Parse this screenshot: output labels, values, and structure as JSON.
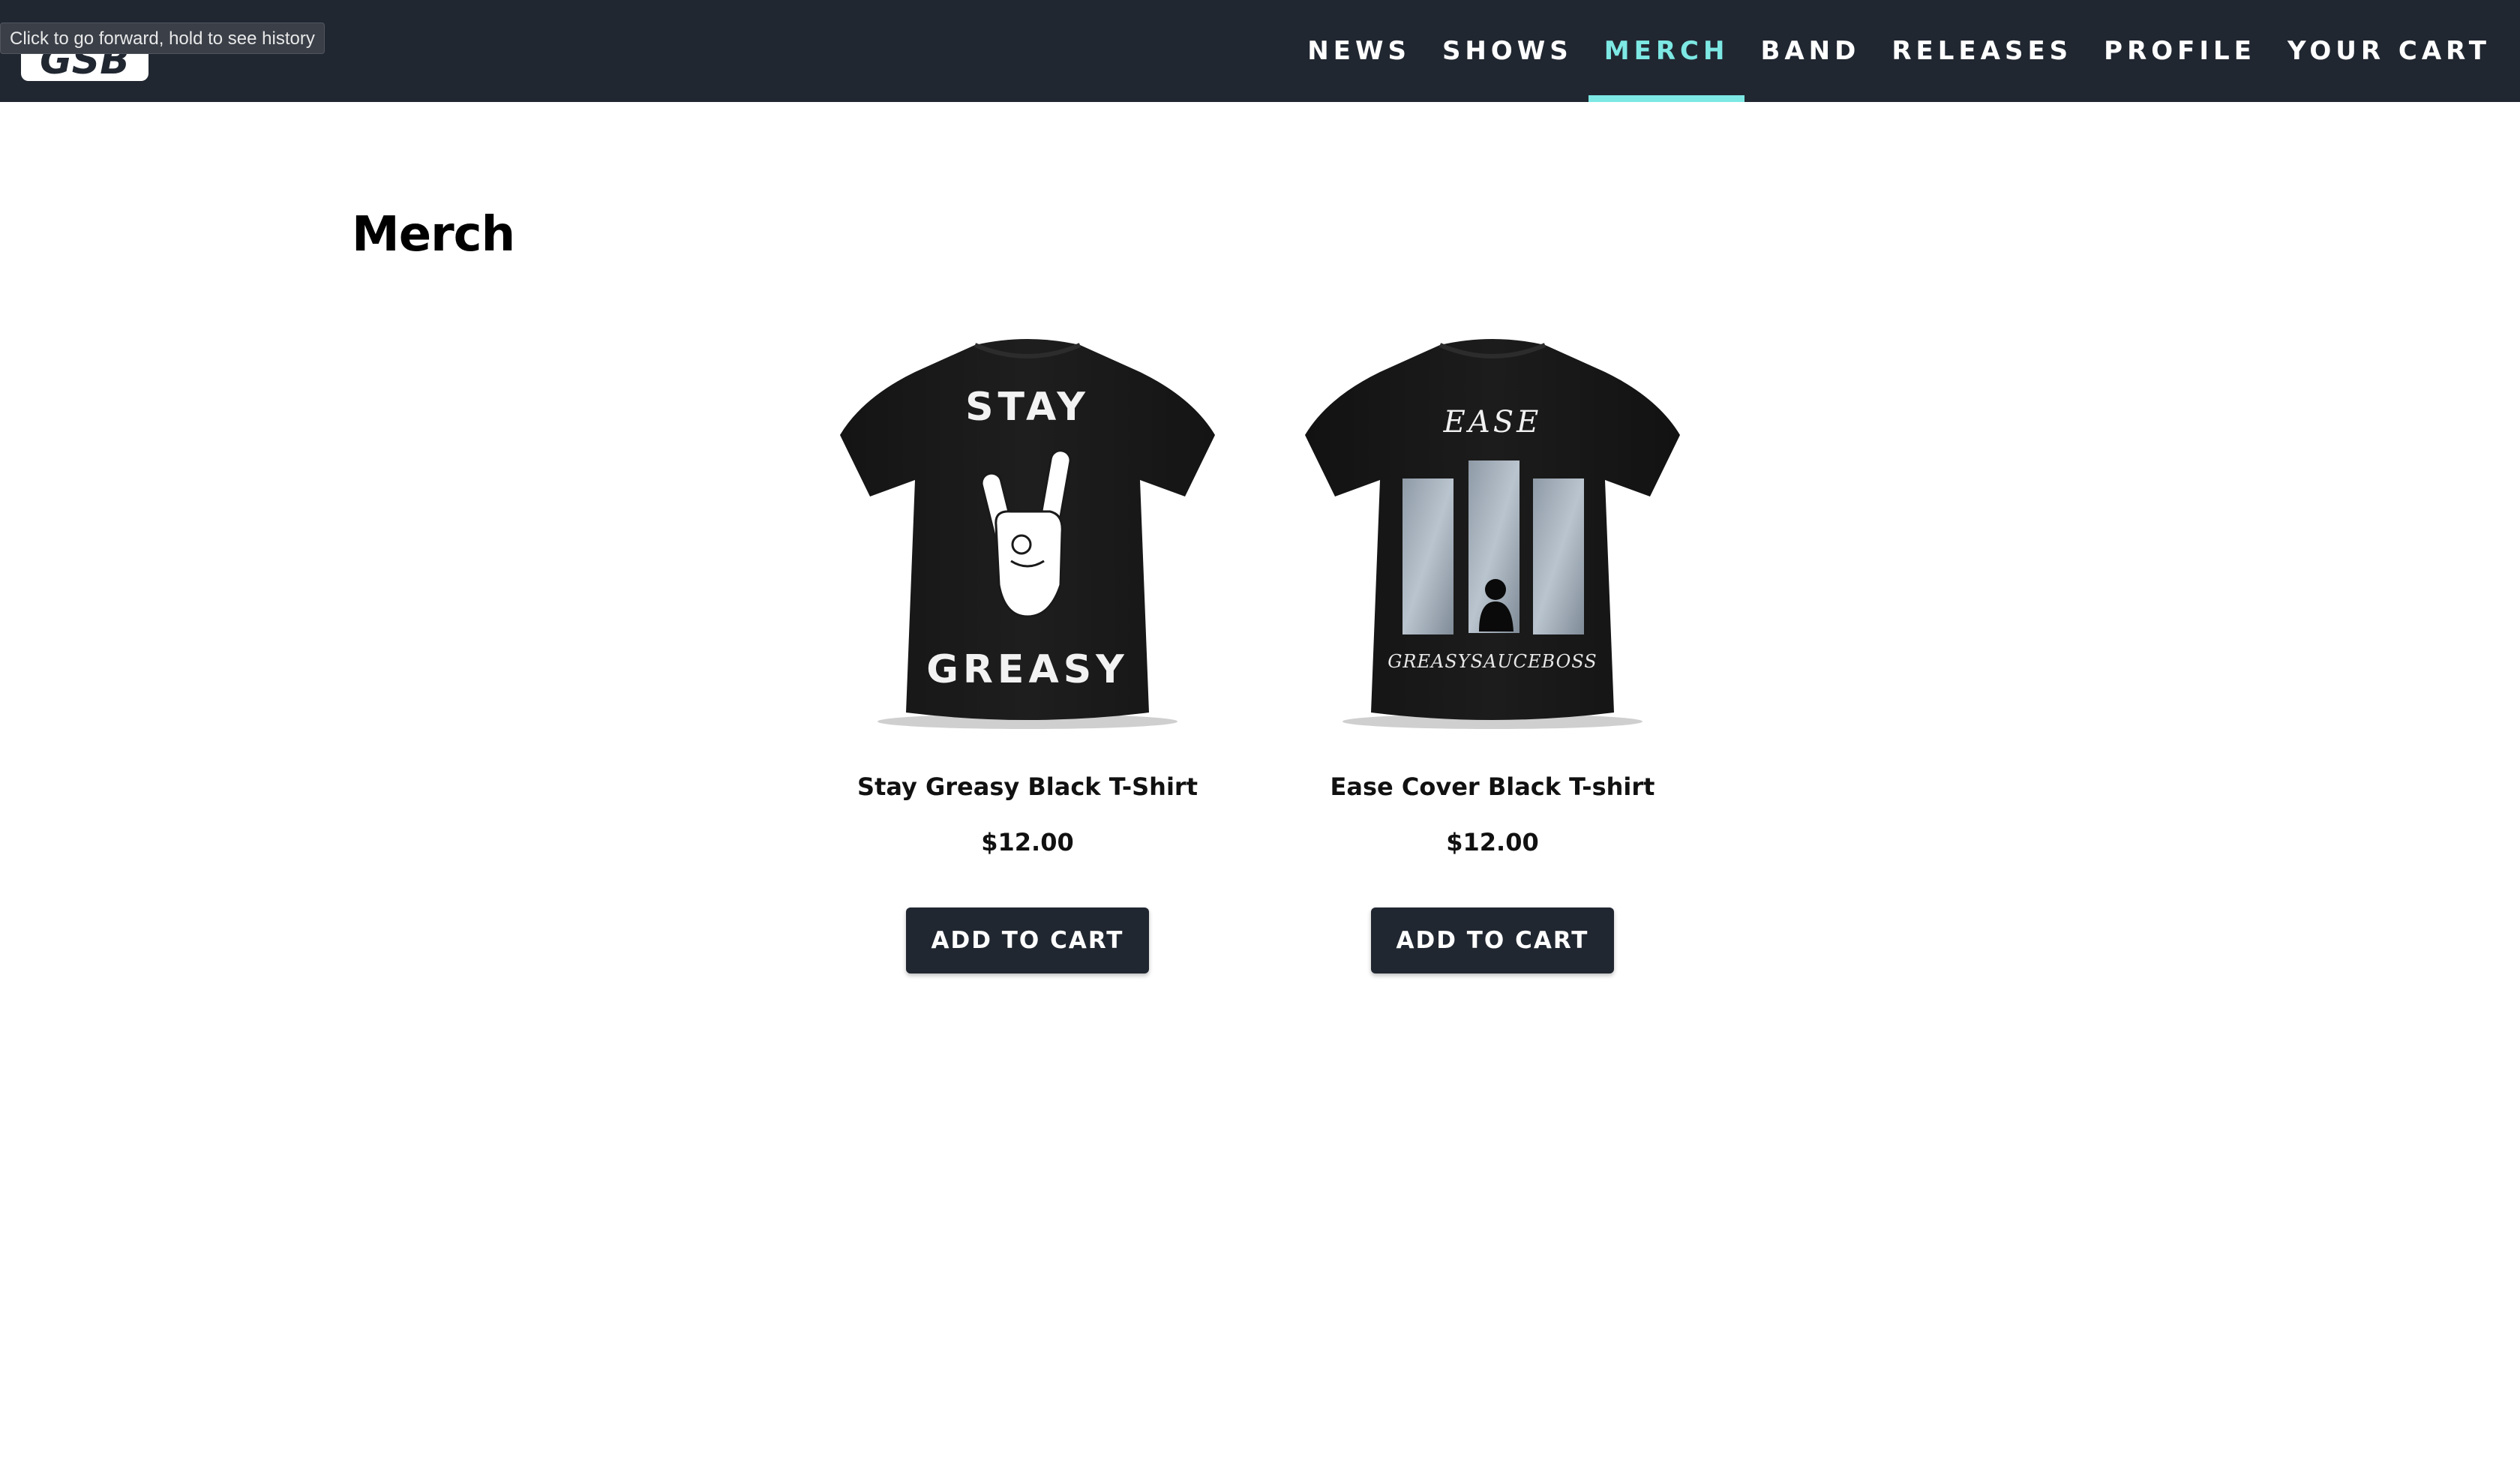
{
  "browser": {
    "tooltip": "Click to go forward, hold to see history"
  },
  "header": {
    "logo_text": "GSB",
    "nav": [
      {
        "label": "NEWS",
        "active": false
      },
      {
        "label": "SHOWS",
        "active": false
      },
      {
        "label": "MERCH",
        "active": true
      },
      {
        "label": "BAND",
        "active": false
      },
      {
        "label": "RELEASES",
        "active": false
      },
      {
        "label": "PROFILE",
        "active": false
      },
      {
        "label": "YOUR CART",
        "active": false
      }
    ]
  },
  "main": {
    "title": "Merch",
    "products": [
      {
        "name": "Stay Greasy Black T-Shirt",
        "price": "$12.00",
        "button": "ADD TO CART",
        "print_top": "STAY",
        "print_bottom": "GREASY"
      },
      {
        "name": "Ease Cover Black T-shirt",
        "price": "$12.00",
        "button": "ADD TO CART",
        "print_top": "EASE",
        "print_bottom": "GREASYSAUCEBOSS"
      }
    ]
  },
  "colors": {
    "navbar": "#212731",
    "accent": "#7de8e4",
    "button": "#212731"
  }
}
